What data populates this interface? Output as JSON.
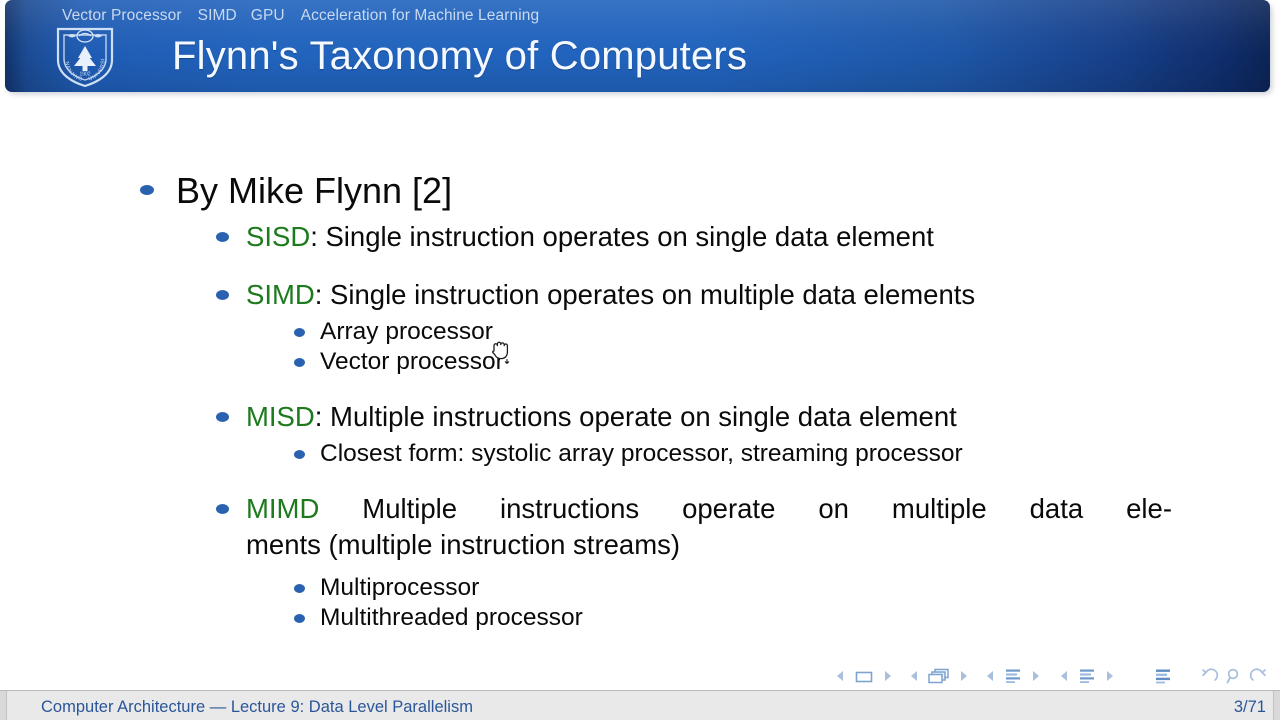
{
  "header": {
    "nav_items": [
      {
        "label": "Vector Processor"
      },
      {
        "label": "SIMD"
      },
      {
        "label": "GPU"
      },
      {
        "label": "Acceleration for Machine Learning"
      }
    ],
    "title": "Flynn's Taxonomy of Computers",
    "logo_name": "nanjing-university-shield-logo",
    "logo_text_top": "NANJING",
    "logo_text_bottom": "UNIVERSITY",
    "logo_year": "1902",
    "colors": {
      "bar_center": "#2163bd",
      "bar_edge": "#0c2456",
      "nav_text": "#c9d9ef",
      "title_text": "#f4f8ff"
    }
  },
  "content": {
    "level1": {
      "text": "By Mike Flynn [2]"
    },
    "items": [
      {
        "code": "SISD",
        "separator": ": ",
        "description": "Single instruction operates on single data element",
        "children": []
      },
      {
        "code": "SIMD",
        "separator": ": ",
        "description": "Single instruction operates on multiple data elements",
        "children": [
          "Array processor",
          "Vector processor"
        ]
      },
      {
        "code": "MISD",
        "separator": ": ",
        "description": "Multiple instructions operate on single data element",
        "children": [
          "Closest form: systolic array processor, streaming processor"
        ]
      },
      {
        "code": "MIMD",
        "separator": ": ",
        "description": "Multiple instructions operate on multiple data ele-ments (multiple instruction streams)",
        "line1_words": [
          "Multiple",
          "instructions",
          "operate",
          "on",
          "multiple",
          "data",
          "ele-"
        ],
        "line2": "ments (multiple instruction streams)",
        "children": [
          "Multiprocessor",
          "Multithreaded processor"
        ]
      }
    ],
    "colors": {
      "code_green": "#1d7a1d",
      "bullet_blue": "#2a62b0",
      "body_text": "#0a0a0a"
    }
  },
  "cursor": {
    "type": "grab-hand-cursor"
  },
  "navbar": {
    "groups": [
      {
        "name": "slide-navigation",
        "prev_icon": "triangle-left-icon",
        "center_icon": "single-slide-icon",
        "next_icon": "triangle-right-icon"
      },
      {
        "name": "frame-navigation",
        "prev_icon": "triangle-left-icon",
        "center_icon": "stacked-frames-icon",
        "next_icon": "triangle-right-icon"
      },
      {
        "name": "subsection-navigation",
        "prev_icon": "triangle-left-icon",
        "center_icon": "subsection-lines-icon",
        "next_icon": "triangle-right-icon"
      },
      {
        "name": "section-navigation",
        "prev_icon": "triangle-left-icon",
        "center_icon": "section-lines-icon",
        "next_icon": "triangle-right-icon"
      }
    ],
    "doc_icon": "document-lines-icon",
    "back_icon": "back-arrow-icon",
    "search_icon": "magnifier-icon",
    "forward_icon": "forward-arrow-icon",
    "icon_color": "#aabfdc"
  },
  "footer": {
    "left": "Computer Architecture — Lecture 9: Data Level Parallelism",
    "right": "3/71",
    "text_color": "#2a5699",
    "background": "#e9e9e9"
  }
}
